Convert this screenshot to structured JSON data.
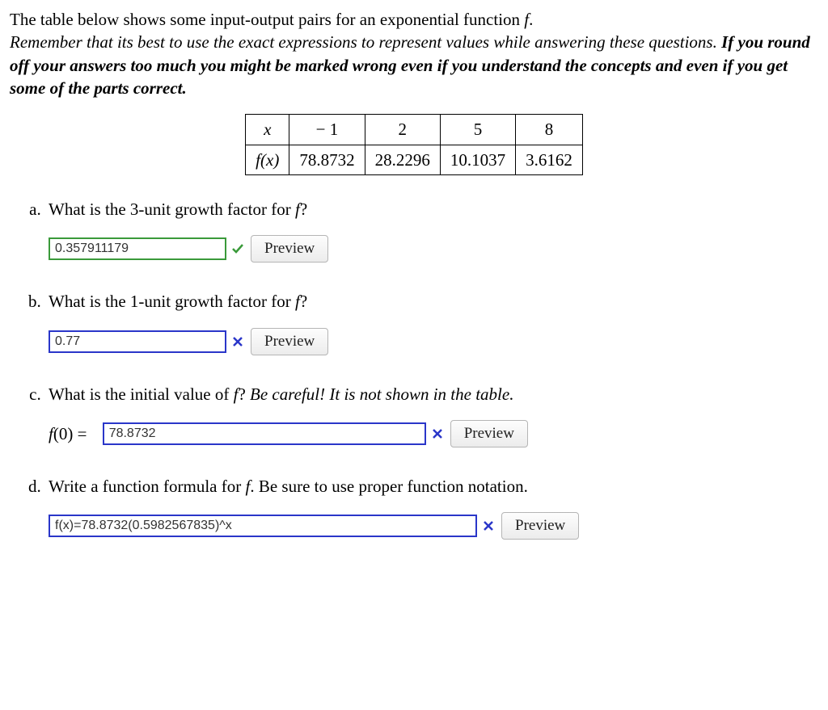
{
  "intro": {
    "line1_pre": "The table below shows some input-output pairs for an exponential function ",
    "line1_var": "f",
    "line1_post": ".",
    "line2": "Remember that its best to use the exact expressions to represent values while answering these questions. ",
    "bold": "If you round off your answers too much you might be marked wrong even if you understand the concepts and even if you get some of the parts correct."
  },
  "table": {
    "header_x": "x",
    "header_fx": "f(x)",
    "cols": [
      "− 1",
      "2",
      "5",
      "8"
    ],
    "vals": [
      "78.8732",
      "28.2296",
      "10.1037",
      "3.6162"
    ]
  },
  "questions": {
    "a": {
      "text_pre": "What is the 3-unit growth factor for ",
      "text_var": "f",
      "text_post": "?",
      "value": "0.357911179",
      "status": "correct",
      "preview": "Preview"
    },
    "b": {
      "text_pre": "What is the 1-unit growth factor for ",
      "text_var": "f",
      "text_post": "?",
      "value": "0.77",
      "status": "wrong",
      "preview": "Preview"
    },
    "c": {
      "text_pre": "What is the initial value of ",
      "text_var": "f",
      "text_post": "? ",
      "text_italic": "Be careful! It is not shown in the table.",
      "prefix_fx": "f(0) = ",
      "value": "78.8732",
      "status": "wrong",
      "preview": "Preview"
    },
    "d": {
      "text_pre": "Write a function formula for ",
      "text_var": "f",
      "text_post": ". Be sure to use proper function notation.",
      "value": "f(x)=78.8732(0.5982567835)^x",
      "status": "wrong",
      "preview": "Preview"
    }
  }
}
